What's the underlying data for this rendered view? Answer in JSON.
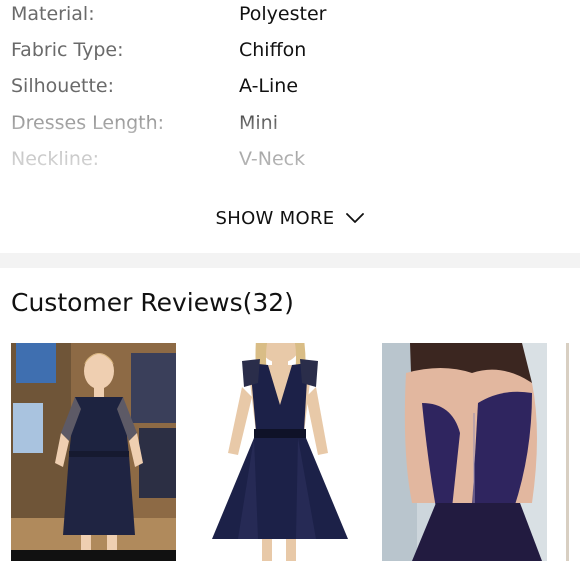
{
  "specs": {
    "rows": [
      {
        "label": "Material:",
        "value": "Polyester"
      },
      {
        "label": "Fabric Type:",
        "value": "Chiffon"
      },
      {
        "label": "Silhouette:",
        "value": "A-Line"
      },
      {
        "label": "Dresses Length:",
        "value": "Mini"
      },
      {
        "label": "Neckline:",
        "value": "V-Neck"
      }
    ],
    "show_more_label": "SHOW MORE",
    "show_more_icon": "chevron-down-icon"
  },
  "reviews": {
    "title": "Customer Reviews(32)",
    "photo_count": 4
  },
  "colors": {
    "label": "#6a6a6a",
    "value": "#111111",
    "separator": "#f3f3f3",
    "dress_navy": "#1b1f3e"
  }
}
